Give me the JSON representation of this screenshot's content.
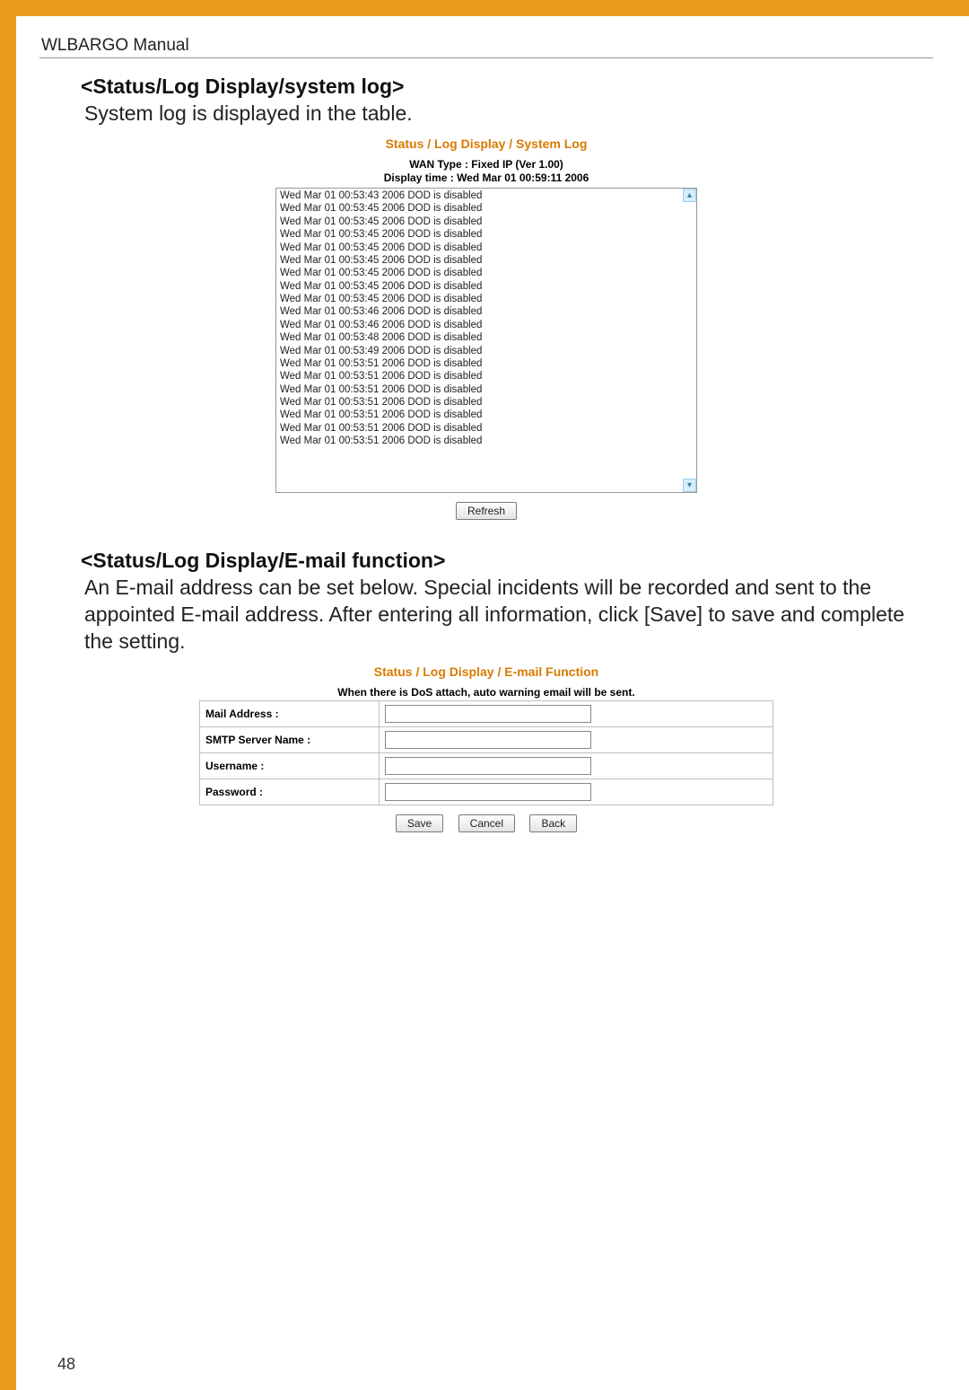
{
  "manual_title": "WLBARGO Manual",
  "page_number": "48",
  "section1": {
    "heading": "<Status/Log Display/system log>",
    "body": "System log is displayed in the table.",
    "panel_title": "Status / Log Display / System Log",
    "wan_type": "WAN Type : Fixed IP (Ver 1.00)",
    "display_time": "Display time : Wed Mar 01 00:59:11 2006",
    "log_lines": [
      "Wed Mar 01 00:53:43 2006 DOD is disabled",
      "Wed Mar 01 00:53:45 2006 DOD is disabled",
      "Wed Mar 01 00:53:45 2006 DOD is disabled",
      "Wed Mar 01 00:53:45 2006 DOD is disabled",
      "Wed Mar 01 00:53:45 2006 DOD is disabled",
      "Wed Mar 01 00:53:45 2006 DOD is disabled",
      "Wed Mar 01 00:53:45 2006 DOD is disabled",
      "Wed Mar 01 00:53:45 2006 DOD is disabled",
      "Wed Mar 01 00:53:45 2006 DOD is disabled",
      "Wed Mar 01 00:53:46 2006 DOD is disabled",
      "Wed Mar 01 00:53:46 2006 DOD is disabled",
      "Wed Mar 01 00:53:48 2006 DOD is disabled",
      "Wed Mar 01 00:53:49 2006 DOD is disabled",
      "Wed Mar 01 00:53:51 2006 DOD is disabled",
      "Wed Mar 01 00:53:51 2006 DOD is disabled",
      "Wed Mar 01 00:53:51 2006 DOD is disabled",
      "Wed Mar 01 00:53:51 2006 DOD is disabled",
      "Wed Mar 01 00:53:51 2006 DOD is disabled",
      "Wed Mar 01 00:53:51 2006 DOD is disabled",
      "Wed Mar 01 00:53:51 2006 DOD is disabled"
    ],
    "refresh_label": "Refresh"
  },
  "section2": {
    "heading": "<Status/Log Display/E-mail function>",
    "body": "An E-mail address can be set below. Special incidents will be recorded and sent to the appointed E-mail address. After entering all information, click [Save] to save and complete the setting.",
    "panel_title": "Status / Log Display / E-mail Function",
    "note": "When there is DoS attach, auto warning email will be sent.",
    "fields": {
      "mail_address_label": "Mail Address :",
      "smtp_label": "SMTP Server Name :",
      "username_label": "Username :",
      "password_label": "Password :"
    },
    "buttons": {
      "save": "Save",
      "cancel": "Cancel",
      "back": "Back"
    }
  }
}
